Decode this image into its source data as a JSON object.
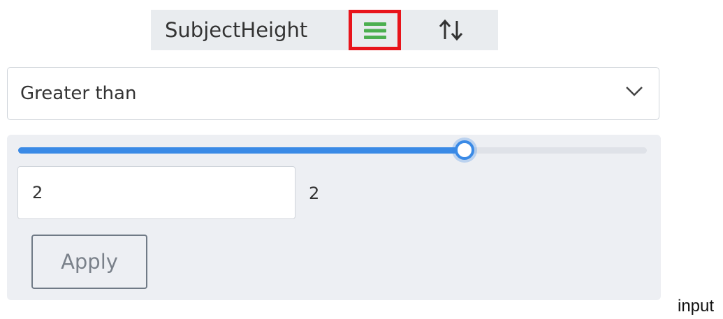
{
  "header": {
    "title": "SubjectHeight",
    "filter_icon": "filter-lines-icon",
    "sort_icon": "sort-arrows-icon",
    "sort_glyph": "↑↓"
  },
  "condition": {
    "selected": "Greater than",
    "chevron_icon": "chevron-down-icon"
  },
  "range": {
    "fraction": 0.71,
    "input_value": "2",
    "readout": "2",
    "apply_label": "Apply"
  },
  "caption": "input",
  "colors": {
    "header_bg": "#e9ecef",
    "highlight_border": "#e8141b",
    "filter_icon": "#4caf50",
    "slider_fill": "#3a8ae6",
    "slider_track": "#dfe2e8",
    "panel_bg": "#edeff3"
  }
}
